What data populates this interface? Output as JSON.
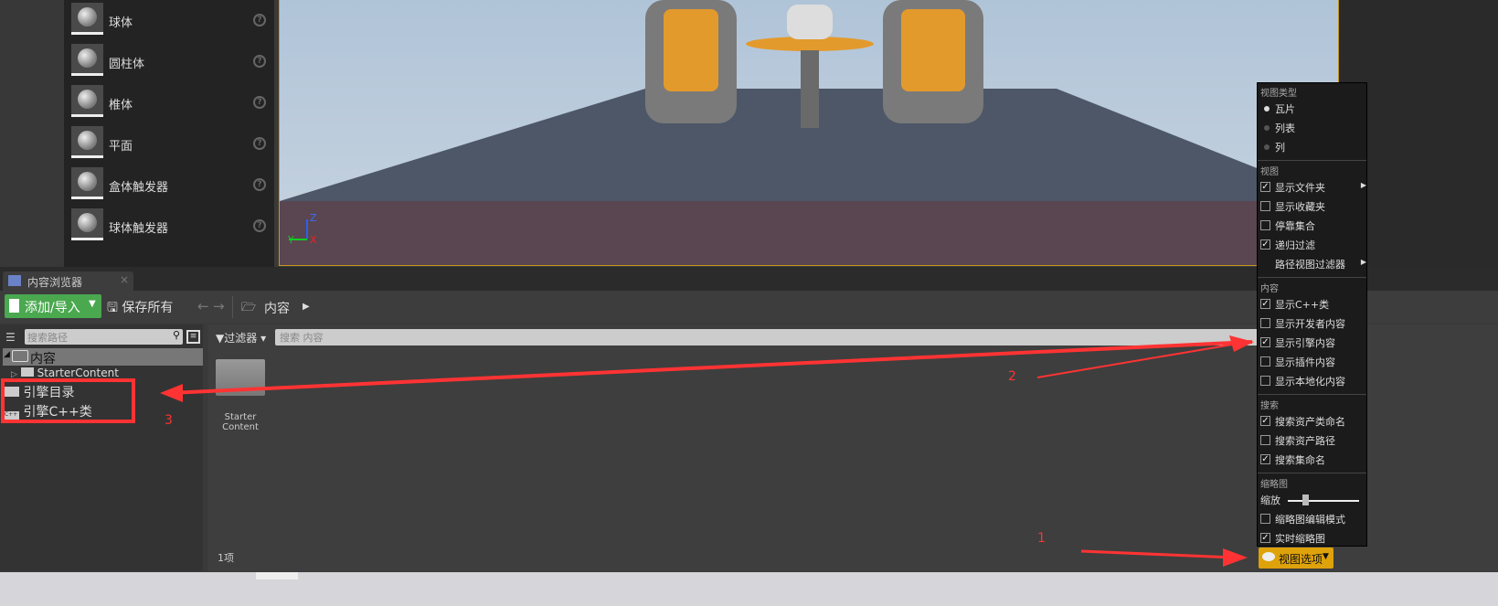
{
  "place_panel": {
    "items": [
      {
        "label": "球体",
        "icon": "sphere-icon"
      },
      {
        "label": "圆柱体",
        "icon": "cylinder-icon"
      },
      {
        "label": "椎体",
        "icon": "cone-icon"
      },
      {
        "label": "平面",
        "icon": "plane-icon"
      },
      {
        "label": "盒体触发器",
        "icon": "box-trigger-icon"
      },
      {
        "label": "球体触发器",
        "icon": "sphere-trigger-icon"
      }
    ],
    "help_glyph": "?"
  },
  "viewport": {
    "axis_z": "Z",
    "axis_y": "Y",
    "axis_x": "X"
  },
  "content_browser": {
    "tab_title": "内容浏览器",
    "tab_close": "×",
    "toolbar": {
      "add_import": "添加/导入",
      "save_all": "保存所有",
      "breadcrumb": "内容"
    },
    "path_search_placeholder": "搜索路径",
    "tree": [
      {
        "label": "内容",
        "expanded": true
      },
      {
        "label": "StarterContent"
      },
      {
        "label": "引擎目录"
      },
      {
        "label": "引擎C++类"
      }
    ],
    "filter_label": "过滤器",
    "content_search_placeholder": "搜索 内容",
    "assets": [
      {
        "name_line1": "Starter",
        "name_line2": "Content"
      }
    ],
    "item_count": "1项"
  },
  "view_options_menu": {
    "sections": [
      {
        "header": "视图类型",
        "items": [
          {
            "label": "瓦片",
            "type": "radio",
            "checked": true
          },
          {
            "label": "列表",
            "type": "radio",
            "checked": false
          },
          {
            "label": "列",
            "type": "radio",
            "checked": false
          }
        ]
      },
      {
        "header": "视图",
        "items": [
          {
            "label": "显示文件夹",
            "type": "check",
            "checked": true,
            "submenu": true
          },
          {
            "label": "显示收藏夹",
            "type": "check",
            "checked": false
          },
          {
            "label": "停靠集合",
            "type": "check",
            "checked": false
          },
          {
            "label": "递归过滤",
            "type": "check",
            "checked": true
          },
          {
            "label": "路径视图过滤器",
            "type": "none",
            "submenu": true
          }
        ]
      },
      {
        "header": "内容",
        "items": [
          {
            "label": "显示C++类",
            "type": "check",
            "checked": true
          },
          {
            "label": "显示开发者内容",
            "type": "check",
            "checked": false
          },
          {
            "label": "显示引擎内容",
            "type": "check",
            "checked": true
          },
          {
            "label": "显示插件内容",
            "type": "check",
            "checked": false
          },
          {
            "label": "显示本地化内容",
            "type": "check",
            "checked": false
          }
        ]
      },
      {
        "header": "搜索",
        "items": [
          {
            "label": "搜索资产类命名",
            "type": "check",
            "checked": true
          },
          {
            "label": "搜索资产路径",
            "type": "check",
            "checked": false
          },
          {
            "label": "搜索集命名",
            "type": "check",
            "checked": true
          }
        ]
      },
      {
        "header": "缩略图",
        "items": [
          {
            "label": "缩放",
            "type": "slider",
            "value": 0.2
          },
          {
            "label": "缩略图编辑模式",
            "type": "check",
            "checked": false
          },
          {
            "label": "实时缩略图",
            "type": "check",
            "checked": true
          }
        ]
      }
    ],
    "button_label": "视图选项"
  },
  "annotations": {
    "n1": "1",
    "n2": "2",
    "n3": "3",
    "color": "#f33"
  }
}
